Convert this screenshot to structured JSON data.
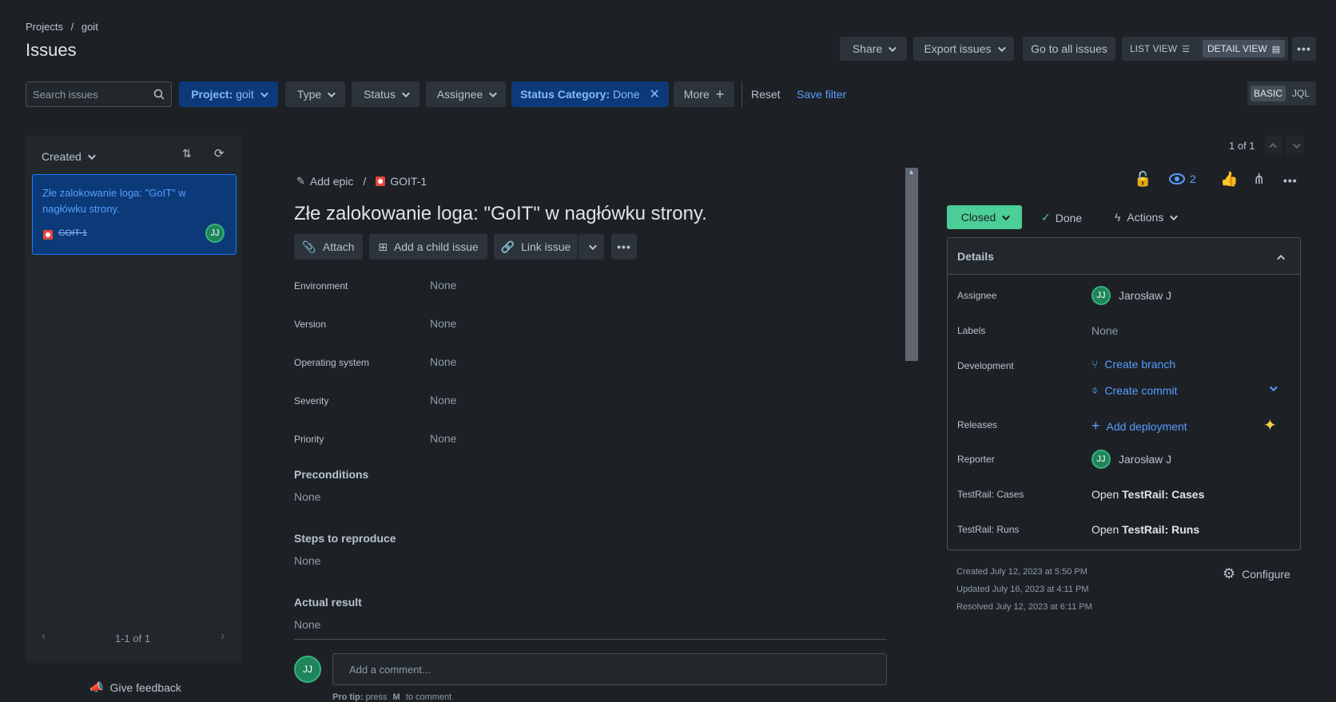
{
  "breadcrumb": {
    "projects": "Projects",
    "sep": "/",
    "project": "goit"
  },
  "page_title": "Issues",
  "header_actions": {
    "share": "Share",
    "export": "Export issues",
    "go_all": "Go to all issues",
    "list_view": "LIST VIEW",
    "detail_view": "DETAIL VIEW",
    "more": "•••"
  },
  "filters": {
    "search_placeholder": "Search issues",
    "project_key": "Project:",
    "project_val": "goit",
    "type": "Type",
    "status": "Status",
    "assignee": "Assignee",
    "status_cat_key": "Status Category:",
    "status_cat_val": "Done",
    "more": "More",
    "reset": "Reset",
    "save_filter": "Save filter",
    "basic": "BASIC",
    "jql": "JQL"
  },
  "list": {
    "sort_label": "Created",
    "items": [
      {
        "title": "Złe zalokowanie loga: \"GoIT\" w nagłówku strony.",
        "key": "GOIT-1",
        "avatar": "JJ"
      }
    ],
    "pagination": "1-1 of 1",
    "feedback": "Give feedback"
  },
  "pager": {
    "count": "1 of 1"
  },
  "issue": {
    "add_epic": "Add epic",
    "sep": "/",
    "key": "GOIT-1",
    "title": "Złe zalokowanie loga: \"GoIT\" w nagłówku strony.",
    "actions": {
      "attach": "Attach",
      "child": "Add a child issue",
      "link": "Link issue"
    },
    "fields": [
      {
        "label": "Environment",
        "value": "None"
      },
      {
        "label": "Version",
        "value": "None"
      },
      {
        "label": "Operating system",
        "value": "None"
      },
      {
        "label": "Severity",
        "value": "None"
      },
      {
        "label": "Priority",
        "value": "None"
      }
    ],
    "sections": [
      {
        "label": "Preconditions",
        "value": "None"
      },
      {
        "label": "Steps to reproduce",
        "value": "None"
      },
      {
        "label": "Actual result",
        "value": "None"
      }
    ],
    "comment_avatar": "JJ",
    "comment_placeholder": "Add a comment...",
    "pro_tip_a": "Pro tip:",
    "pro_tip_b": "press",
    "pro_tip_key": "M",
    "pro_tip_c": "to comment"
  },
  "sidebar": {
    "watchers": "2",
    "status": "Closed",
    "resolution": "Done",
    "actions": "Actions",
    "details_title": "Details",
    "assignee_label": "Assignee",
    "assignee": "Jarosław J",
    "assignee_avatar": "JJ",
    "labels_label": "Labels",
    "labels": "None",
    "dev_label": "Development",
    "create_branch": "Create branch",
    "create_commit": "Create commit",
    "releases_label": "Releases",
    "add_deployment": "Add deployment",
    "reporter_label": "Reporter",
    "reporter": "Jarosław J",
    "reporter_avatar": "JJ",
    "tr_cases_label": "TestRail: Cases",
    "tr_cases_open": "Open",
    "tr_cases_val": "TestRail: Cases",
    "tr_runs_label": "TestRail: Runs",
    "tr_runs_open": "Open",
    "tr_runs_val": "TestRail: Runs",
    "created": "Created July 12, 2023 at 5:50 PM",
    "updated": "Updated July 16, 2023 at 4:11 PM",
    "resolved": "Resolved July 12, 2023 at 6:11 PM",
    "configure": "Configure"
  },
  "colors": {
    "bg": "#1d2125",
    "accent": "#579dff",
    "status_green": "#4bce97",
    "selected_bg": "#0c3a78"
  }
}
